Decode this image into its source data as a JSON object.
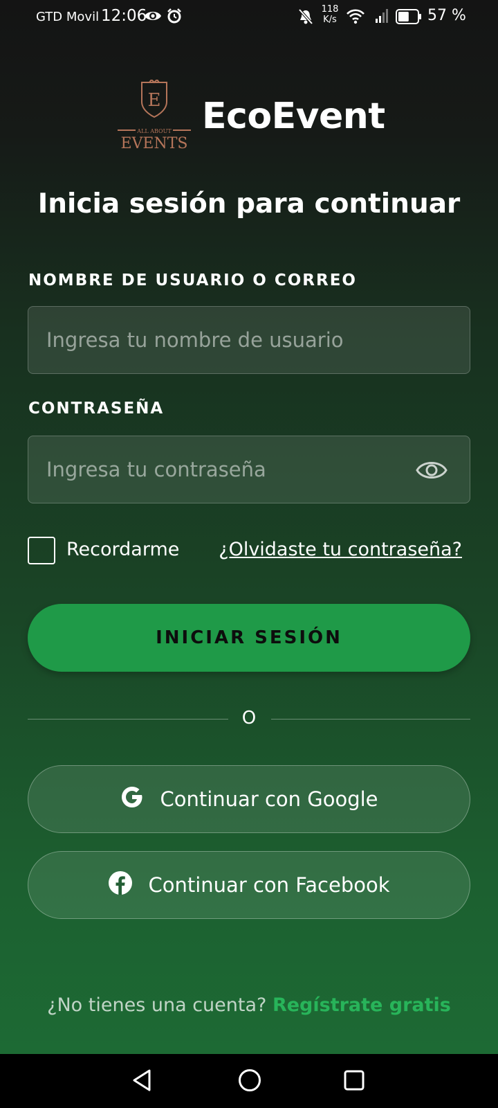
{
  "status_bar": {
    "carrier": "GTD Movil",
    "time": "12:06",
    "speed_value": "118",
    "speed_unit": "K/s",
    "battery_percent": "57 %",
    "battery_level": 0.57,
    "icons": [
      "eye-icon",
      "alarm-icon",
      "bell-off-icon",
      "wifi-icon",
      "signal-icon",
      "battery-icon"
    ]
  },
  "logo": {
    "letter": "E",
    "small_text": "ALL ABOUT",
    "big_text": "EVENTS"
  },
  "app": {
    "title": "EcoEvent"
  },
  "login": {
    "heading": "Inicia sesión para continuar",
    "username_label": "NOMBRE DE USUARIO O CORREO",
    "username_placeholder": "Ingresa tu nombre de usuario",
    "username_value": "",
    "password_label": "CONTRASEÑA",
    "password_placeholder": "Ingresa tu contraseña",
    "password_value": "",
    "remember_label": "Recordarme",
    "remember_checked": false,
    "forgot_link": "¿Olvidaste tu contraseña?",
    "submit_label": "INICIAR SESIÓN"
  },
  "divider": {
    "text": "O"
  },
  "social": {
    "google_label": "Continuar con Google",
    "facebook_label": "Continuar con Facebook"
  },
  "signup": {
    "text": "¿No tienes una cuenta?",
    "link": "Regístrate gratis"
  },
  "colors": {
    "accent_green": "#1f9a48",
    "link_green": "#28b45a",
    "logo_copper": "#b5755a"
  },
  "nav_bar": {
    "icons": [
      "back-icon",
      "home-icon",
      "recent-apps-icon"
    ]
  }
}
